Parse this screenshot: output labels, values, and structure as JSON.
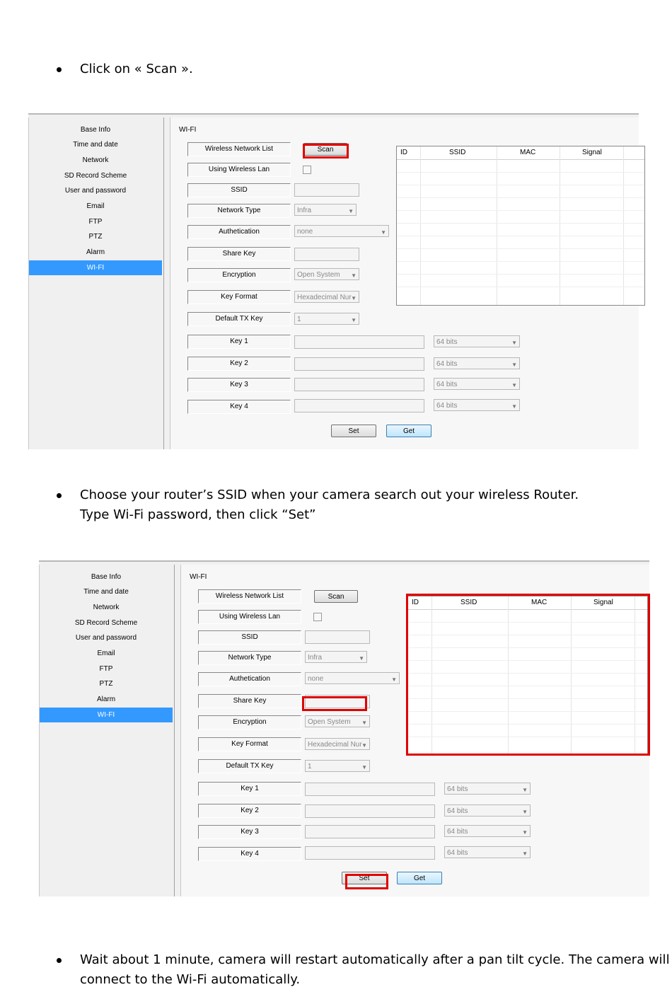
{
  "steps": [
    {
      "text": "Click on  « Scan »."
    },
    {
      "text_line1": "Choose your router’s SSID when your camera search out your wireless Router.",
      "text_line2": "Type Wi-Fi password, then click “Set”"
    },
    {
      "text_line1": "Wait about 1 minute, camera will restart automatically after a pan tilt cycle. The camera will",
      "text_line2": "connect to the Wi-Fi automatically."
    }
  ],
  "ui": {
    "sidebar": [
      "Base Info",
      "Time and date",
      "Network",
      "SD Record Scheme",
      "User and password",
      "Email",
      "FTP",
      "PTZ",
      "Alarm",
      "WI-FI"
    ],
    "group_title": "WI-FI",
    "labels": {
      "wireless_network_list": "Wireless Network List",
      "using_wireless_lan": "Using Wireless Lan",
      "ssid": "SSID",
      "network_type": "Network Type",
      "authentication": "Authetication",
      "share_key": "Share Key",
      "encryption": "Encryption",
      "key_format": "Key Format",
      "default_tx_key": "Default TX Key",
      "key1": "Key 1",
      "key2": "Key 2",
      "key3": "Key 3",
      "key4": "Key 4"
    },
    "values": {
      "network_type": "Infra",
      "authentication": "none",
      "encryption": "Open System",
      "key_format": "Hexadecimal Nur",
      "default_tx_key": "1",
      "key_bits": "64 bits"
    },
    "buttons": {
      "scan": "Scan",
      "set": "Set",
      "get": "Get"
    },
    "table_headers": [
      "ID",
      "SSID",
      "MAC",
      "Signal"
    ],
    "highlight_color": "#e00000",
    "selected_color": "#3399ff"
  }
}
